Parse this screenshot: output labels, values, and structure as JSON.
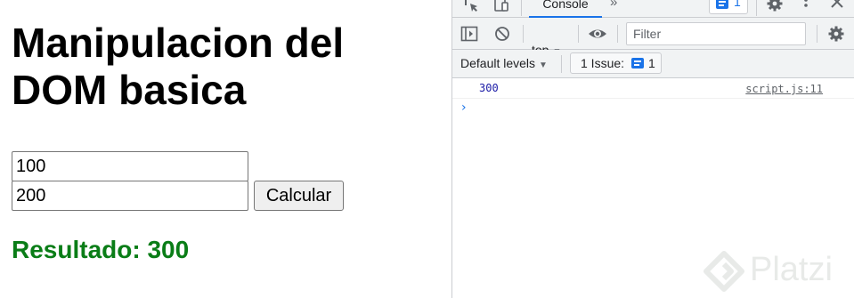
{
  "page": {
    "title": "Manipulacion del DOM basica",
    "input1_value": "100",
    "input2_value": "200",
    "button_label": "Calcular",
    "result_text": "Resultado: 300"
  },
  "devtools": {
    "tabs": {
      "active": "Console",
      "more": "»"
    },
    "issues_badge_count": "1",
    "context": "top",
    "filter_placeholder": "Filter",
    "default_levels": "Default levels",
    "issues_button": {
      "label": "1 Issue:",
      "count": "1"
    },
    "console_log": {
      "value": "300",
      "source": "script.js:11"
    },
    "prompt": "›"
  },
  "watermark": {
    "text": "Platzi"
  },
  "colors": {
    "result_green": "#0a7d17",
    "accent_blue": "#1a73e8"
  },
  "icons": [
    "inspect-icon",
    "device-toggle-icon",
    "settings-gear-icon",
    "kebab-menu-icon",
    "close-icon",
    "sidebar-toggle-icon",
    "clear-console-icon",
    "eye-icon",
    "message-icon",
    "platzi-logo"
  ]
}
